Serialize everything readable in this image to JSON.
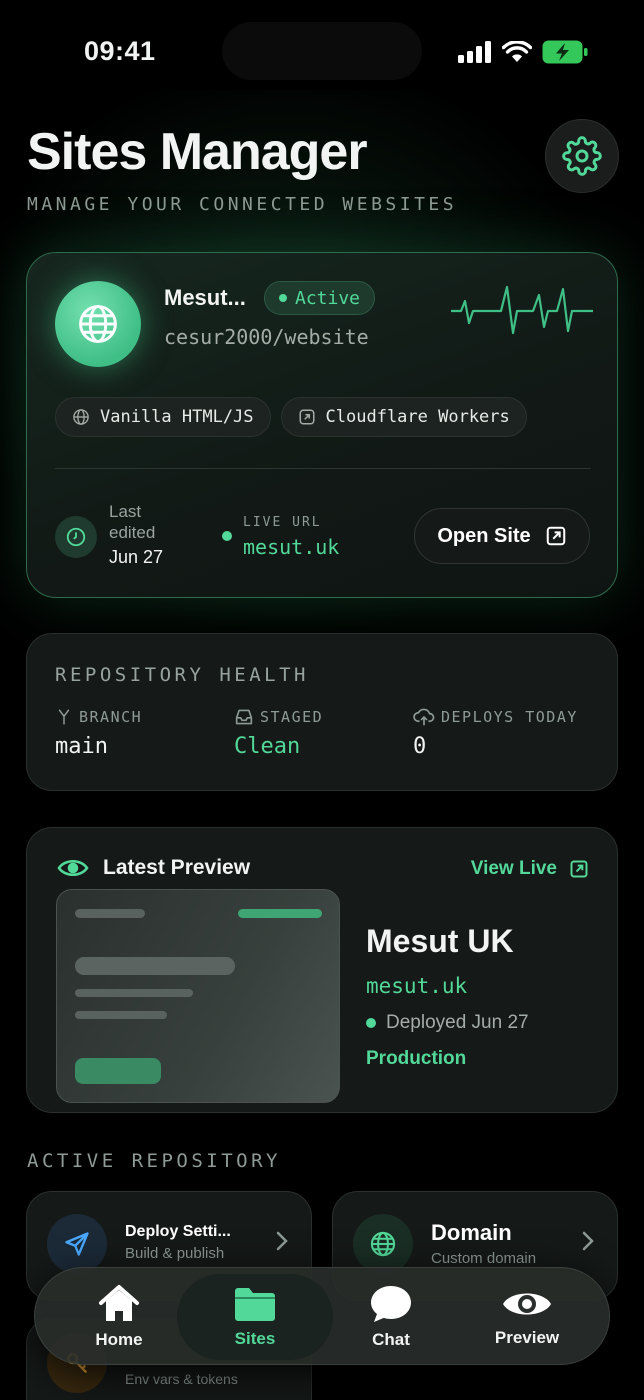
{
  "status_bar": {
    "time": "09:41"
  },
  "header": {
    "title": "Sites Manager",
    "subtitle": "MANAGE YOUR CONNECTED WEBSITES"
  },
  "site_card": {
    "name": "Mesut...",
    "status": "Active",
    "repo": "cesur2000/website",
    "chips": [
      "Vanilla HTML/JS",
      "Cloudflare Workers"
    ],
    "last_edited_label": "Last edited",
    "last_edited_date": "Jun 27",
    "live_url_label": "LIVE URL",
    "live_url": "mesut.uk",
    "open_button": "Open Site"
  },
  "repo_health": {
    "title": "REPOSITORY HEALTH",
    "branch_label": "BRANCH",
    "branch_value": "main",
    "staged_label": "STAGED",
    "staged_value": "Clean",
    "deploys_label": "DEPLOYS TODAY",
    "deploys_value": "0"
  },
  "preview": {
    "title": "Latest Preview",
    "view_live": "View Live",
    "site_title": "Mesut UK",
    "url": "mesut.uk",
    "deployed": "Deployed Jun 27",
    "environment": "Production"
  },
  "active_repository": {
    "title": "ACTIVE REPOSITORY",
    "tiles": [
      {
        "title": "Deploy Setti...",
        "subtitle": "Build & publish"
      },
      {
        "title": "Domain",
        "subtitle": "Custom domain"
      },
      {
        "title": "",
        "subtitle": "Env vars & tokens"
      }
    ]
  },
  "tab_bar": {
    "tabs": [
      "Home",
      "Sites",
      "Chat",
      "Preview"
    ],
    "active": "Sites"
  },
  "colors": {
    "accent": "#52d898",
    "background": "#000000",
    "card": "#151918"
  }
}
